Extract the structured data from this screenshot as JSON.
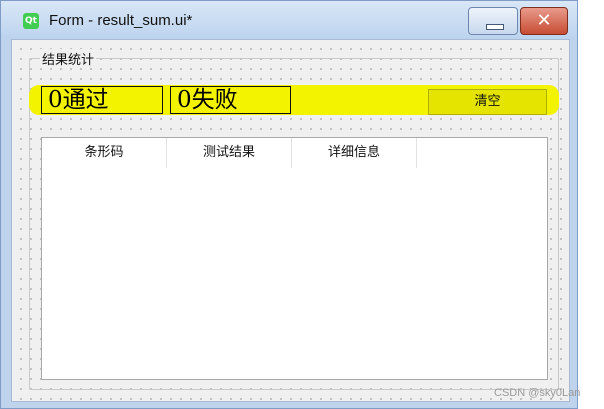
{
  "window": {
    "title": "Form - result_sum.ui*",
    "icon_text": "Qt",
    "close_glyph": "✕"
  },
  "group": {
    "title": "结果统计"
  },
  "counters": {
    "pass_text": "0通过",
    "fail_text": "0失败"
  },
  "clear_button": {
    "label": "清空"
  },
  "table": {
    "columns": [
      "条形码",
      "测试结果",
      "详细信息"
    ]
  },
  "watermark": "CSDN @sky0Lan",
  "colors": {
    "highlight": "#f3f300",
    "clear_button": "#e4e400",
    "close_button": "#c74c33"
  }
}
